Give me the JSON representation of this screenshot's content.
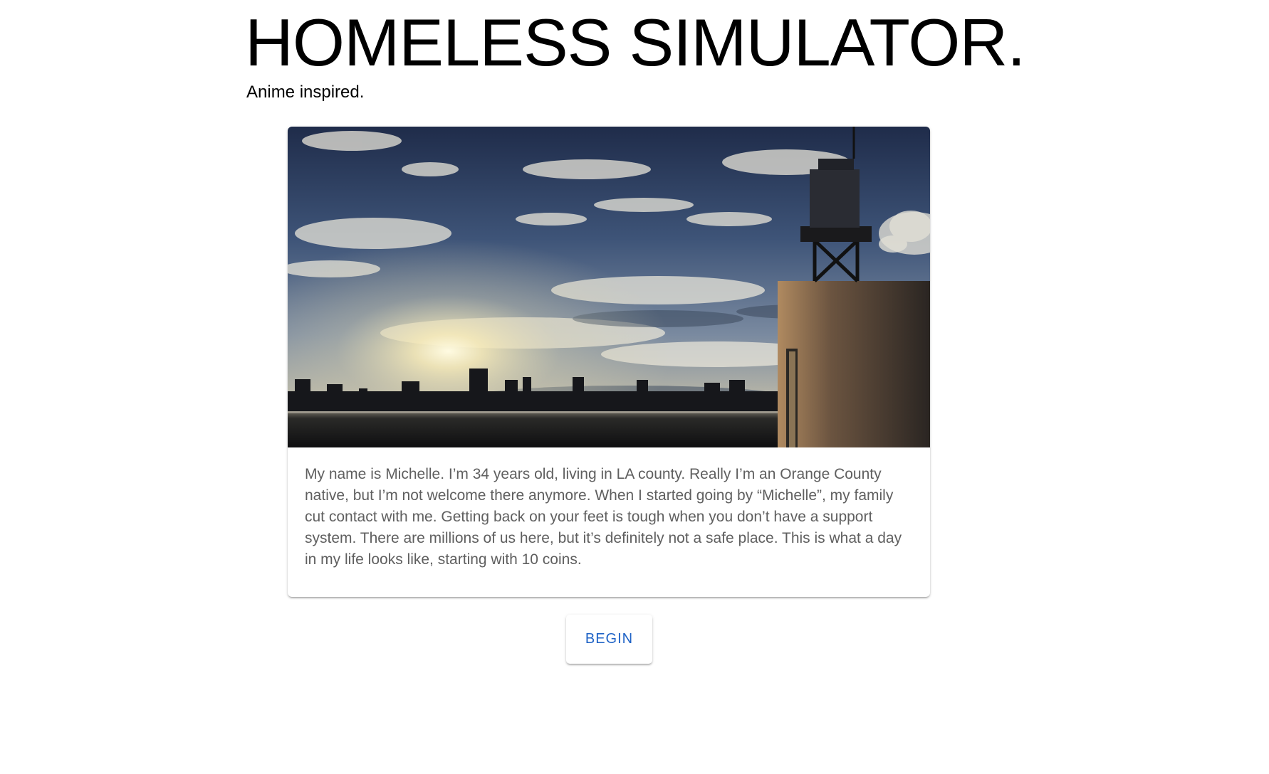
{
  "header": {
    "title": "HOMELESS SIMULATOR.",
    "subtitle": "Anime inspired."
  },
  "card": {
    "image_icon": "anime-rooftop-sunset-cityscape",
    "description": "My name is Michelle. I’m 34 years old, living in LA county. Really I’m an Orange County native, but I’m not welcome there anymore. When I started going by “Michelle”, my family cut contact with me. Getting back on your feet is tough when you don’t have a support system. There are millions of us here, but it’s definitely not a safe place. This is what a day in my life looks like, starting with 10 coins."
  },
  "actions": {
    "begin_label": "BEGIN"
  },
  "colors": {
    "button_text": "#1f63c6",
    "body_text": "#5f5f5f"
  }
}
